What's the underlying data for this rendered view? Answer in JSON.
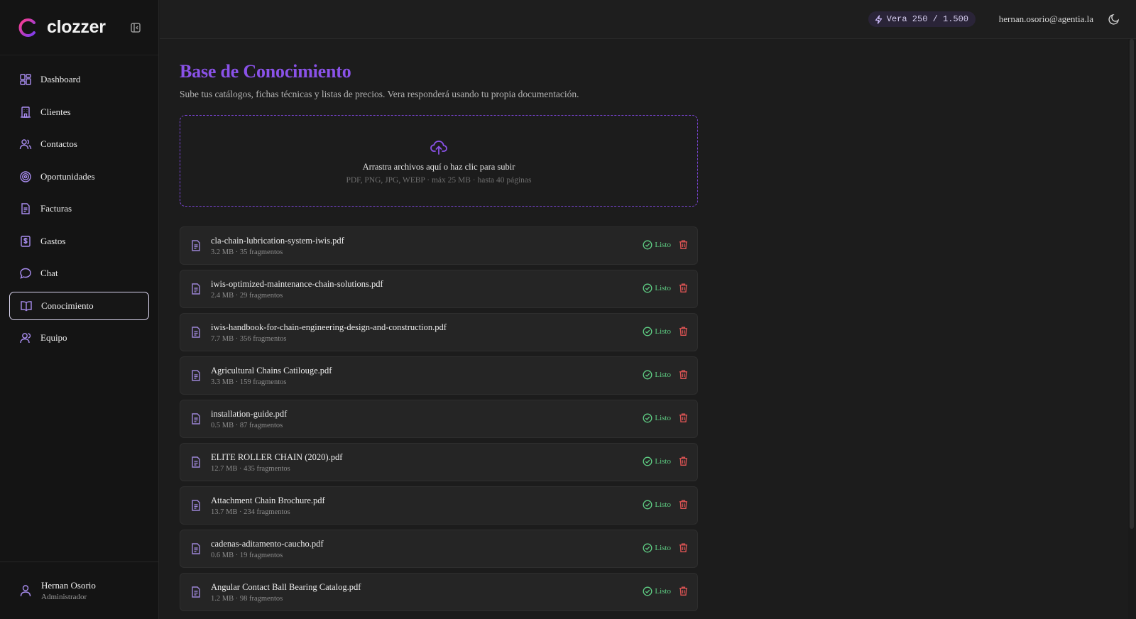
{
  "brand": {
    "name": "clozzer"
  },
  "sidebar": {
    "items": [
      {
        "label": "Dashboard",
        "icon": "dashboard-icon"
      },
      {
        "label": "Clientes",
        "icon": "building-icon"
      },
      {
        "label": "Contactos",
        "icon": "users-icon"
      },
      {
        "label": "Oportunidades",
        "icon": "target-icon"
      },
      {
        "label": "Facturas",
        "icon": "document-icon"
      },
      {
        "label": "Gastos",
        "icon": "dollar-receipt-icon"
      },
      {
        "label": "Chat",
        "icon": "chat-bubble-icon"
      },
      {
        "label": "Conocimiento",
        "icon": "book-icon",
        "active": true
      },
      {
        "label": "Equipo",
        "icon": "user-icon"
      }
    ],
    "user": {
      "name": "Hernan Osorio",
      "role": "Administrador"
    }
  },
  "topbar": {
    "usage": "Vera 250 / 1.500",
    "email": "hernan.osorio@agentia.la"
  },
  "page": {
    "title": "Base de Conocimiento",
    "subtitle": "Sube tus catálogos, fichas técnicas y listas de precios. Vera responderá usando tu propia documentación.",
    "dropzone_title": "Arrastra archivos aquí o haz clic para subir",
    "dropzone_hint": "PDF, PNG, JPG, WEBP · máx 25 MB · hasta 40 páginas"
  },
  "files": [
    {
      "name": "cla-chain-lubrication-system-iwis.pdf",
      "meta": "3.2 MB · 35 fragmentos",
      "status": "Listo"
    },
    {
      "name": "iwis-optimized-maintenance-chain-solutions.pdf",
      "meta": "2.4 MB · 29 fragmentos",
      "status": "Listo"
    },
    {
      "name": "iwis-handbook-for-chain-engineering-design-and-construction.pdf",
      "meta": "7.7 MB · 356 fragmentos",
      "status": "Listo"
    },
    {
      "name": "Agricultural Chains Catilouge.pdf",
      "meta": "3.3 MB · 159 fragmentos",
      "status": "Listo"
    },
    {
      "name": "installation-guide.pdf",
      "meta": "0.5 MB · 87 fragmentos",
      "status": "Listo"
    },
    {
      "name": "ELITE ROLLER CHAIN (2020).pdf",
      "meta": "12.7 MB · 435 fragmentos",
      "status": "Listo"
    },
    {
      "name": "Attachment Chain Brochure.pdf",
      "meta": "13.7 MB · 234 fragmentos",
      "status": "Listo"
    },
    {
      "name": "cadenas-aditamento-caucho.pdf",
      "meta": "0.6 MB · 19 fragmentos",
      "status": "Listo"
    },
    {
      "name": "Angular Contact Ball Bearing Catalog.pdf",
      "meta": "1.2 MB · 98 fragmentos",
      "status": "Listo"
    }
  ],
  "colors": {
    "accent": "#8a52e8",
    "success": "#5fcf84",
    "danger": "#e05555",
    "background": "#1c1c1c",
    "sidebar": "#141414"
  }
}
